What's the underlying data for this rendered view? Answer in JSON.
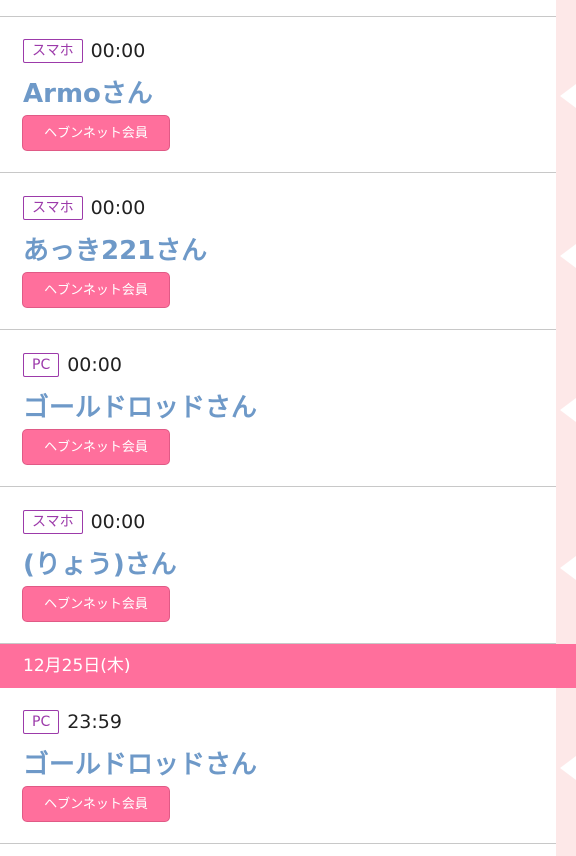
{
  "entries": [
    {
      "device": "スマホ",
      "time": "00:00",
      "name": "Armoさん",
      "badge": "ヘブンネット会員"
    },
    {
      "device": "スマホ",
      "time": "00:00",
      "name": "あっき221さん",
      "badge": "ヘブンネット会員"
    },
    {
      "device": "PC",
      "time": "00:00",
      "name": "ゴールドロッドさん",
      "badge": "ヘブンネット会員"
    },
    {
      "device": "スマホ",
      "time": "00:00",
      "name": "(りょう)さん",
      "badge": "ヘブンネット会員"
    }
  ],
  "date_header": "12月25日(木)",
  "entries_after": [
    {
      "device": "PC",
      "time": "23:59",
      "name": "ゴールドロッドさん",
      "badge": "ヘブンネット会員"
    }
  ],
  "colors": {
    "accent_pink": "#ff6f9c",
    "name_blue": "#6e99c8",
    "tag_purple": "#9c3aaa",
    "side_pink": "#fde8e8"
  }
}
